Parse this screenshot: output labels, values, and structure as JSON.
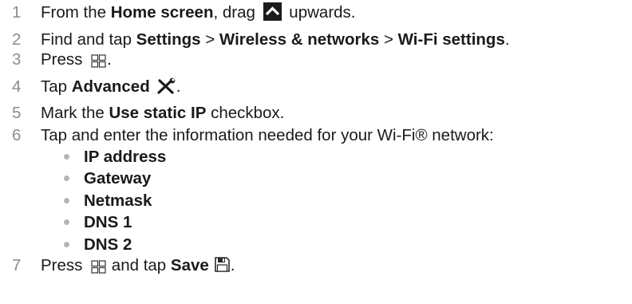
{
  "steps": [
    {
      "num": "1",
      "a": "From the ",
      "b": "Home screen",
      "c": ", drag ",
      "d": " upwards."
    },
    {
      "num": "2",
      "a": "Find and tap ",
      "b": "Settings",
      "c": " > ",
      "d": "Wireless & networks",
      "e": " > ",
      "f": "Wi-Fi settings",
      "g": "."
    },
    {
      "num": "3",
      "a": "Press ",
      "b": "."
    },
    {
      "num": "4",
      "a": "Tap ",
      "b": "Advanced",
      "c": "."
    },
    {
      "num": "5",
      "a": "Mark the ",
      "b": "Use static IP",
      "c": " checkbox."
    },
    {
      "num": "6",
      "a": "Tap and enter the information needed for your Wi-Fi® network:"
    },
    {
      "num": "7",
      "a": "Press ",
      "b": " and tap ",
      "c": "Save",
      "d": "."
    }
  ],
  "fields": [
    "IP address",
    "Gateway",
    "Netmask",
    "DNS 1",
    "DNS 2"
  ],
  "icons": {
    "up": "up-arrow-icon",
    "menu": "menu-icon",
    "advanced": "tools-icon",
    "save": "save-icon"
  }
}
